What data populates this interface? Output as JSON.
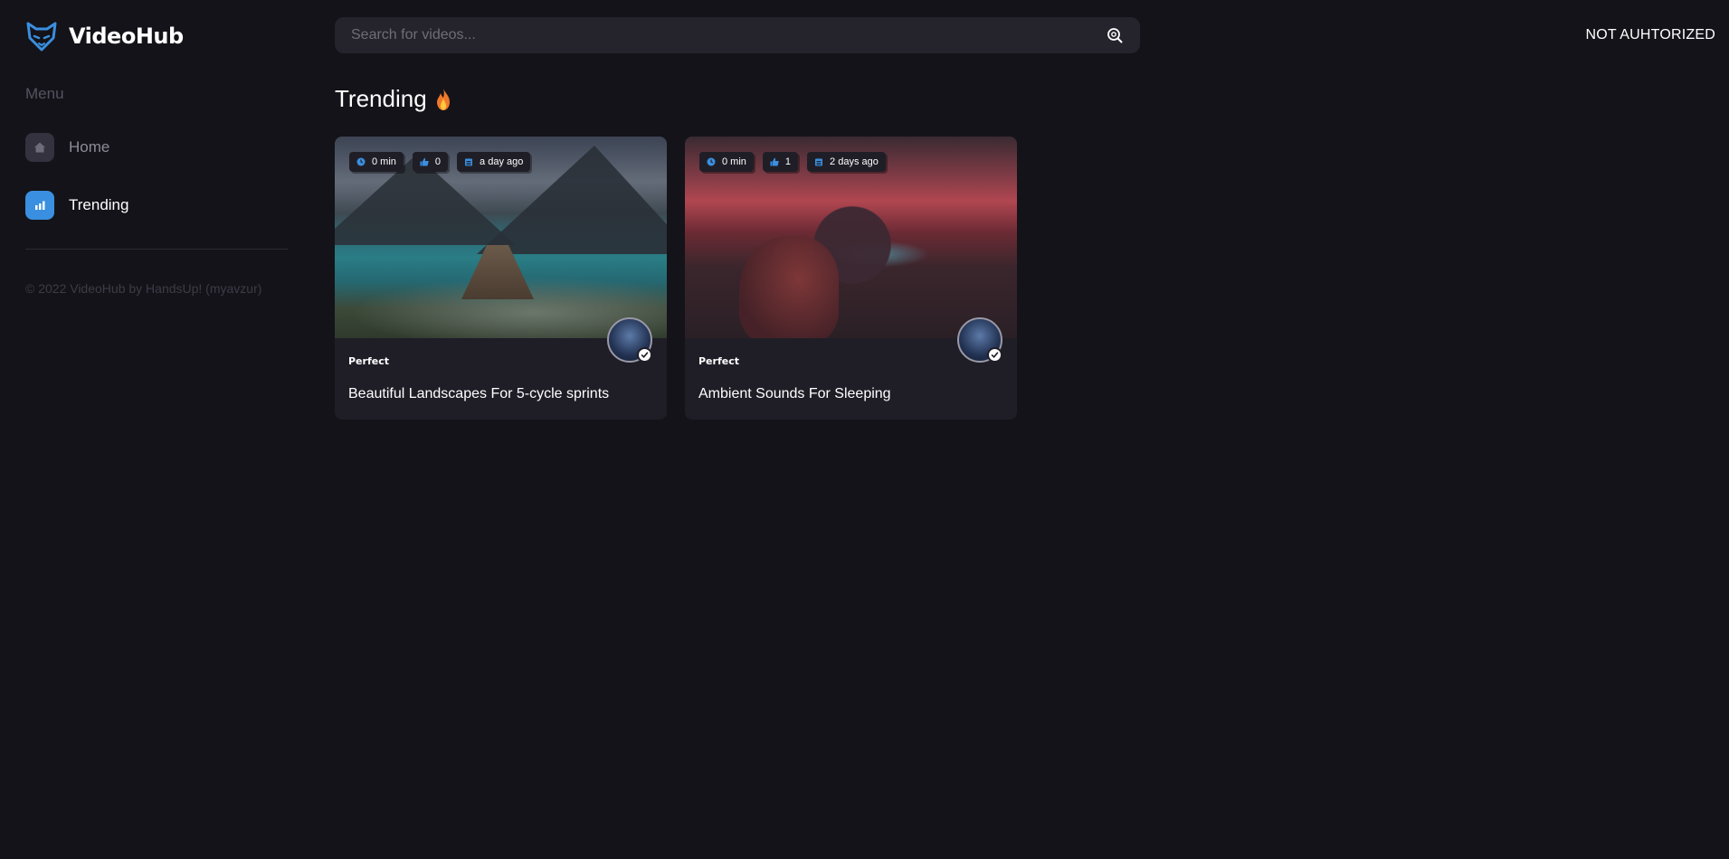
{
  "app": {
    "name": "VideoHub",
    "logo_icon": "fox-icon",
    "accent": "#3a8fe0"
  },
  "search": {
    "placeholder": "Search for videos...",
    "value": "",
    "icon": "search-icon"
  },
  "header": {
    "auth_label": "NOT AUHTORIZED"
  },
  "sidebar": {
    "heading": "Menu",
    "items": [
      {
        "label": "Home",
        "icon": "home-icon",
        "active": false
      },
      {
        "label": "Trending",
        "icon": "bar-chart-icon",
        "active": true
      }
    ],
    "footer": "© 2022 VideoHub by HandsUp! (myavzur)"
  },
  "main": {
    "title": "Trending",
    "title_icon": "fire-icon",
    "videos": [
      {
        "duration": "0 min",
        "likes": "0",
        "posted": "a day ago",
        "category": "Perfect",
        "title": "Beautiful Landscapes For 5-cycle sprints"
      },
      {
        "duration": "0 min",
        "likes": "1",
        "posted": "2 days ago",
        "category": "Perfect",
        "title": "Ambient Sounds For Sleeping"
      }
    ]
  }
}
